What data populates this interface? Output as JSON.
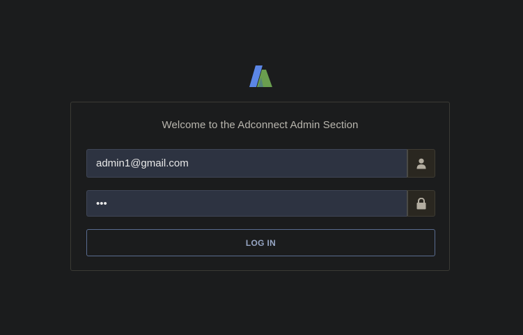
{
  "logo": {
    "icon": "adconnect-logo-icon",
    "colors": {
      "left": "#5b86e5",
      "right": "#6a9e4f"
    }
  },
  "login_card": {
    "title": "Welcome to the Adconnect Admin Section",
    "email": {
      "value": "admin1@gmail.com",
      "icon": "user-icon"
    },
    "password": {
      "value": "•••",
      "icon": "lock-icon"
    },
    "submit_label": "LOG IN"
  },
  "colors": {
    "background": "#1b1c1d",
    "input_bg": "#2d3341",
    "addon_bg": "#2a2720",
    "button_border": "#5a6d91",
    "button_text": "#97a6c4",
    "title_text": "#b9b6ae"
  }
}
